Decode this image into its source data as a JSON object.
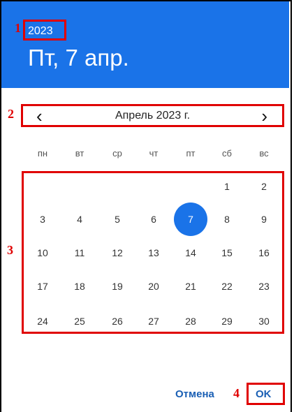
{
  "header": {
    "year": "2023",
    "selected_date": "Пт, 7 апр."
  },
  "month_nav": {
    "prev_glyph": "‹",
    "month_label": "Апрель 2023 г.",
    "next_glyph": "›"
  },
  "weekdays": [
    "пн",
    "вт",
    "ср",
    "чт",
    "пт",
    "сб",
    "вс"
  ],
  "calendar": {
    "selected_day": "7",
    "weeks": [
      [
        "",
        "",
        "",
        "",
        "",
        "1",
        "2"
      ],
      [
        "3",
        "4",
        "5",
        "6",
        "7",
        "8",
        "9"
      ],
      [
        "10",
        "11",
        "12",
        "13",
        "14",
        "15",
        "16"
      ],
      [
        "17",
        "18",
        "19",
        "20",
        "21",
        "22",
        "23"
      ],
      [
        "24",
        "25",
        "26",
        "27",
        "28",
        "29",
        "30"
      ]
    ]
  },
  "actions": {
    "cancel_label": "Отмена",
    "ok_label": "OK"
  },
  "annotations": [
    "1",
    "2",
    "3",
    "4"
  ],
  "colors": {
    "accent": "#1a73e8",
    "annotation": "#e00000",
    "button_text": "#1a5fb4"
  }
}
